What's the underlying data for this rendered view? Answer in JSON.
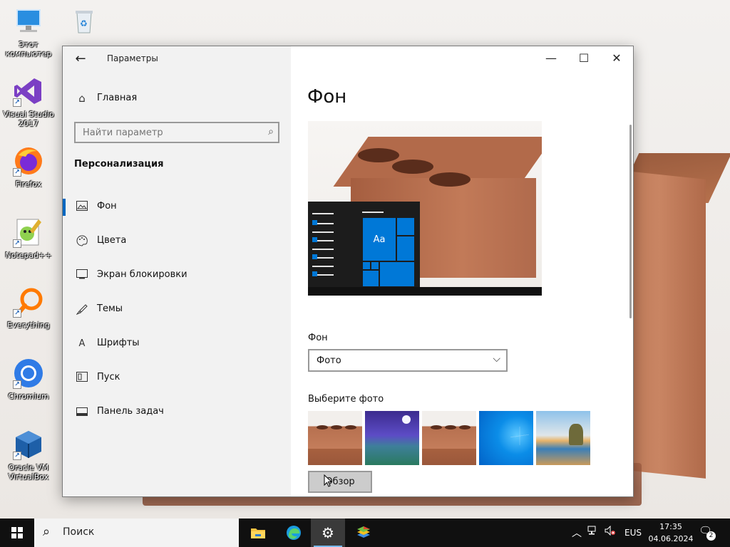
{
  "desktop": {
    "icons": [
      {
        "label": "Этот компьютер",
        "icon": "computer-icon"
      },
      {
        "label": "Visual Studio 2017",
        "icon": "visual-studio-icon"
      },
      {
        "label": "Firefox",
        "icon": "firefox-icon"
      },
      {
        "label": "Notepad++",
        "icon": "notepad-plus-icon"
      },
      {
        "label": "Everything",
        "icon": "everything-icon"
      },
      {
        "label": "Chromium",
        "icon": "chromium-icon"
      },
      {
        "label": "Oracle VM VirtualBox",
        "icon": "virtualbox-icon"
      },
      {
        "label": "",
        "icon": "recycle-bin-icon"
      }
    ]
  },
  "window": {
    "title": "Параметры",
    "controls": {
      "minimize": "—",
      "maximize": "☐",
      "close": "✕"
    },
    "sidebar": {
      "home_label": "Главная",
      "search_placeholder": "Найти параметр",
      "section_title": "Персонализация",
      "items": [
        {
          "label": "Фон",
          "icon": "picture-icon",
          "active": true
        },
        {
          "label": "Цвета",
          "icon": "palette-icon",
          "active": false
        },
        {
          "label": "Экран блокировки",
          "icon": "lock-screen-icon",
          "active": false
        },
        {
          "label": "Темы",
          "icon": "brush-icon",
          "active": false
        },
        {
          "label": "Шрифты",
          "icon": "font-icon",
          "active": false
        },
        {
          "label": "Пуск",
          "icon": "start-icon",
          "active": false
        },
        {
          "label": "Панель задач",
          "icon": "taskbar-icon",
          "active": false
        }
      ]
    },
    "content": {
      "page_title": "Фон",
      "preview_tile_text": "Aa",
      "background_label": "Фон",
      "background_value": "Фото",
      "choose_photo_label": "Выберите фото",
      "thumbnails": [
        "brick",
        "night-lake",
        "brick",
        "windows-blue",
        "beach"
      ],
      "browse_button": "Обзор"
    }
  },
  "taskbar": {
    "search_label": "Поиск",
    "apps": [
      "file-explorer-icon",
      "edge-icon",
      "settings-icon",
      "bluestacks-icon"
    ],
    "active_app": "settings-icon",
    "language": "EUS",
    "time": "17:35",
    "date": "04.06.2024",
    "notification_count": "2"
  },
  "colors": {
    "accent": "#0067c0",
    "tile_blue": "#0078d7",
    "taskbar": "#101010"
  }
}
